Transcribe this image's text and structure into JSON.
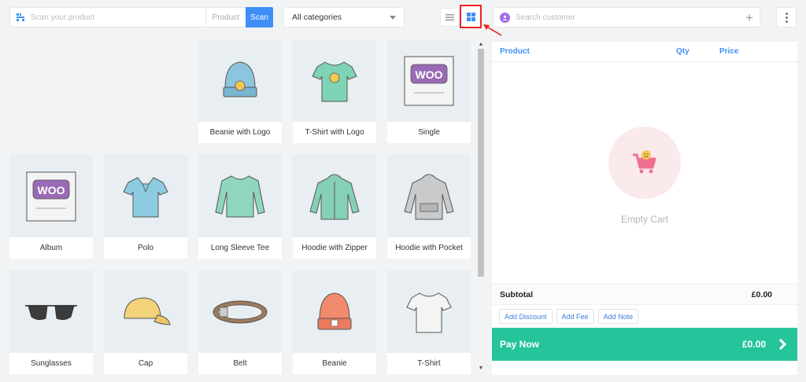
{
  "scan": {
    "placeholder": "Scan your product",
    "product_tag": "Product",
    "scan_label": "Scan"
  },
  "category": {
    "selected": "All categories"
  },
  "customer": {
    "placeholder": "Search customer"
  },
  "products": [
    {
      "name": "Beanie with Logo",
      "icon": "beanie-logo"
    },
    {
      "name": "T-Shirt with Logo",
      "icon": "tshirt-logo"
    },
    {
      "name": "Single",
      "icon": "woo-single"
    },
    {
      "name": "Album",
      "icon": "woo-album"
    },
    {
      "name": "Polo",
      "icon": "polo"
    },
    {
      "name": "Long Sleeve Tee",
      "icon": "longsleeve"
    },
    {
      "name": "Hoodie with Zipper",
      "icon": "hoodie-zip"
    },
    {
      "name": "Hoodie with Pocket",
      "icon": "hoodie-pocket"
    },
    {
      "name": "Sunglasses",
      "icon": "sunglasses"
    },
    {
      "name": "Cap",
      "icon": "cap"
    },
    {
      "name": "Belt",
      "icon": "belt"
    },
    {
      "name": "Beanie",
      "icon": "beanie"
    },
    {
      "name": "T-Shirt",
      "icon": "tshirt"
    }
  ],
  "cart": {
    "col_product": "Product",
    "col_qty": "Qty",
    "col_price": "Price",
    "empty_text": "Empty Cart",
    "subtotal_label": "Subtotal",
    "subtotal_value": "£0.00",
    "add_discount": "Add Discount",
    "add_fee": "Add Fee",
    "add_note": "Add Note",
    "pay_label": "Pay Now",
    "pay_value": "£0.00"
  },
  "colors": {
    "accent": "#3f8ff7",
    "pay": "#25c49b",
    "highlight": "#e22222"
  }
}
